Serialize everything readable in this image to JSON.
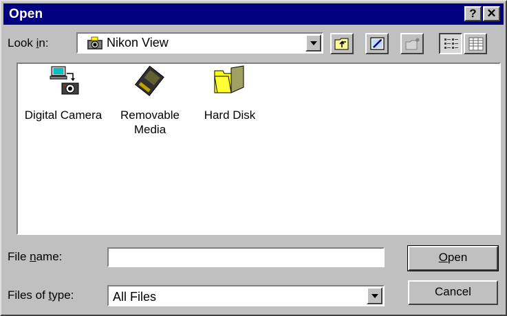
{
  "window": {
    "title": "Open",
    "help_button": "?",
    "close_button": "✕"
  },
  "look_in": {
    "label_pre": "Look ",
    "label_accel": "i",
    "label_post": "n:",
    "value": "Nikon View"
  },
  "toolbar": [
    "up-one-level",
    "desktop",
    "create-new-folder",
    "list-view",
    "details-view"
  ],
  "files": [
    {
      "line1": "Digital Camera",
      "line2": "",
      "icon": "digital-camera-icon"
    },
    {
      "line1": "Removable",
      "line2": "Media",
      "icon": "removable-media-icon"
    },
    {
      "line1": "Hard Disk",
      "line2": "",
      "icon": "folder-icon"
    }
  ],
  "file_name": {
    "label_pre": "File ",
    "label_accel": "n",
    "label_post": "ame:",
    "value": ""
  },
  "files_of_type": {
    "label_pre": "Files of ",
    "label_accel": "t",
    "label_post": "ype:",
    "value": "All Files"
  },
  "buttons": {
    "open_accel": "O",
    "open_rest": "pen",
    "cancel": "Cancel"
  },
  "colors": {
    "titlebar": "#000080",
    "face": "#c0c0c0",
    "folder": "#ffff00"
  }
}
